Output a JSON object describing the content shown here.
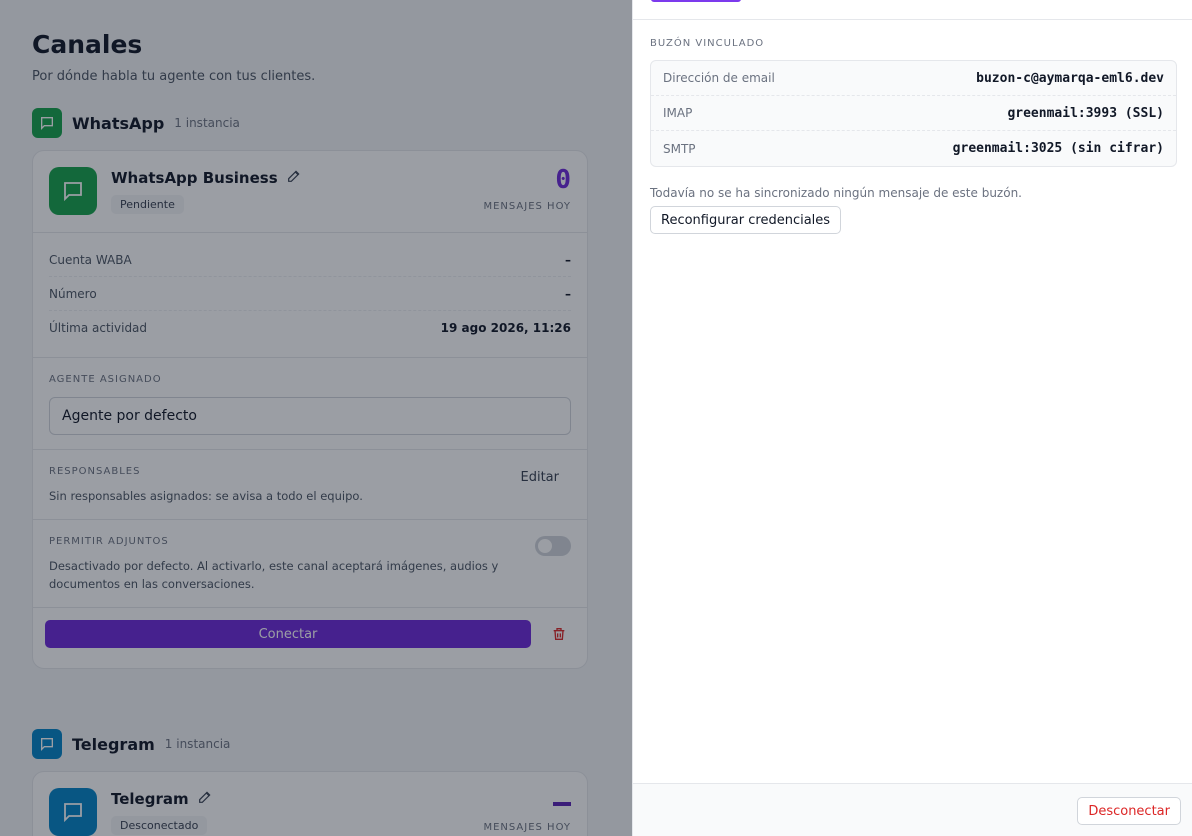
{
  "page": {
    "title": "Canales",
    "subtitle": "Por dónde habla tu agente con tus clientes."
  },
  "colors": {
    "whatsapp": "#16a34a",
    "telegram": "#0284c7",
    "accent": "#6d28d9",
    "danger": "#dc2626"
  },
  "whatsapp": {
    "name": "WhatsApp",
    "count": "1 instancia",
    "icon": "chat-bubble-icon",
    "card": {
      "title": "WhatsApp Business",
      "status": "Pendiente",
      "metric_value": "0",
      "metric_label": "MENSAJES HOY",
      "fields": [
        {
          "key": "Cuenta WABA",
          "value": "–"
        },
        {
          "key": "Número",
          "value": "–"
        },
        {
          "key": "Última actividad",
          "value": "19 ago 2026, 11:26"
        }
      ],
      "agent_label": "AGENTE ASIGNADO",
      "agent_value": "Agente por defecto",
      "responsables_label": "RESPONSABLES",
      "responsables_edit": "Editar",
      "responsables_text": "Sin responsables asignados: se avisa a todo el equipo.",
      "attachments_label": "PERMITIR ADJUNTOS",
      "attachments_text": "Desactivado por defecto. Al activarlo, este canal aceptará imágenes, audios y documentos en las conversaciones.",
      "attachments_enabled": false,
      "connect_label": "Conectar"
    }
  },
  "telegram": {
    "name": "Telegram",
    "count": "1 instancia",
    "icon": "chat-bubble-icon",
    "card": {
      "title": "Telegram",
      "status": "Desconectado",
      "metric_label": "MENSAJES HOY"
    }
  },
  "drawer": {
    "section_label": "BUZÓN VINCULADO",
    "rows": [
      {
        "key": "Dirección de email",
        "value": "buzon-c@aymarqa-eml6.dev"
      },
      {
        "key": "IMAP",
        "value": "greenmail:3993 (SSL)"
      },
      {
        "key": "SMTP",
        "value": "greenmail:3025 (sin cifrar)"
      }
    ],
    "note": "Todavía no se ha sincronizado ningún mensaje de este buzón.",
    "reconfigure_label": "Reconfigurar credenciales",
    "disconnect_label": "Desconectar"
  }
}
